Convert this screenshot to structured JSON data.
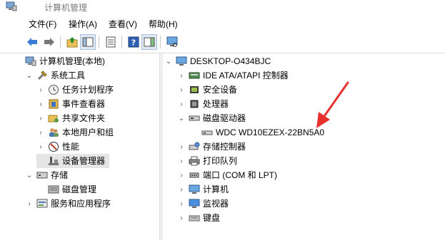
{
  "window": {
    "title": "计算机管理"
  },
  "menu": [
    "文件(F)",
    "操作(A)",
    "查看(V)",
    "帮助(H)"
  ],
  "left_tree": {
    "root": "计算机管理(本地)",
    "system_tools": "系统工具",
    "system_children": [
      "任务计划程序",
      "事件查看器",
      "共享文件夹",
      "本地用户和组",
      "性能",
      "设备管理器"
    ],
    "storage": "存储",
    "storage_children": [
      "磁盘管理"
    ],
    "services": "服务和应用程序"
  },
  "right_tree": {
    "computer": "DESKTOP-O434BJC",
    "items_before": [
      "IDE ATA/ATAPI 控制器",
      "安全设备",
      "处理器"
    ],
    "disk_drives": "磁盘驱动器",
    "disk": "WDC WD10EZEX-22BN5A0",
    "items_after": [
      "存储控制器",
      "打印队列",
      "端口 (COM 和 LPT)",
      "计算机",
      "监视器",
      "键盘"
    ]
  },
  "colors": {
    "annotation_arrow": "#e8312f",
    "selection": "#e5e5e5"
  }
}
